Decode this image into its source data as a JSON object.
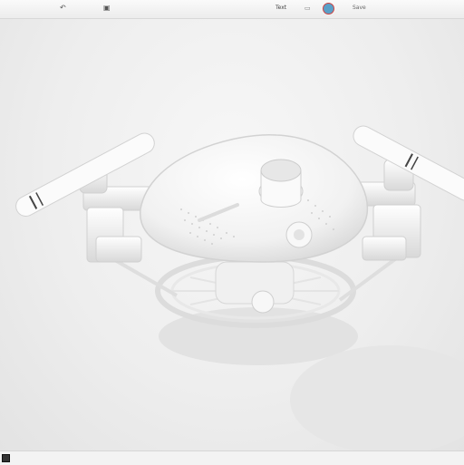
{
  "toolbar": {
    "undo_glyph": "↶",
    "save_glyph": "▣",
    "text_item": "Text",
    "app_item": "▭",
    "label": "Save"
  },
  "icons": {
    "undo": "undo-icon",
    "save": "save-icon",
    "user": "user-avatar-icon",
    "status": "status-icon"
  },
  "colors": {
    "model": "#ffffff",
    "background": "#eeeeee",
    "avatar": "#5aa0c8"
  }
}
